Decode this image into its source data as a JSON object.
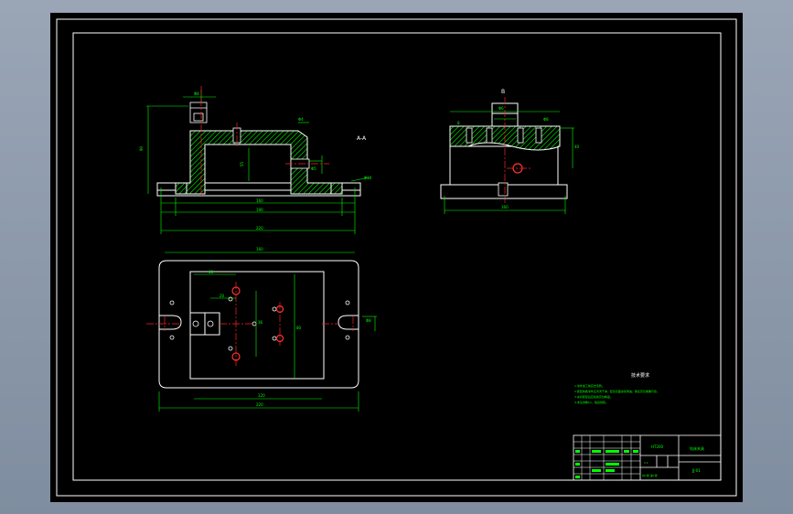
{
  "sheet": {
    "background": "#000000",
    "frame_color": "#ffffff",
    "line_color": "#ffffff",
    "section_color": "#00ff00",
    "dimension_color": "#00ff00",
    "centerline_color": "#ff0000",
    "window_color": "#8c99aa"
  },
  "views": {
    "front_section_label": "A-A",
    "side_view_label": "B"
  },
  "technical_requirements": {
    "title": "技术要求",
    "items": [
      "1.零件加工前应去毛刺。",
      "2.装配前各零件应清洗干净，配合表面涂润滑油，保证定位准确可靠。",
      "3.夹具装配后应检验定位精度。",
      "4.未注倒角C1，锐边倒钝。"
    ]
  },
  "title_block": {
    "drawing_name": "钻床夹具",
    "material": "HT200",
    "drawing_number": "JJ-01",
    "scale": "1:1",
    "sheet": "共1张 第1张"
  }
}
